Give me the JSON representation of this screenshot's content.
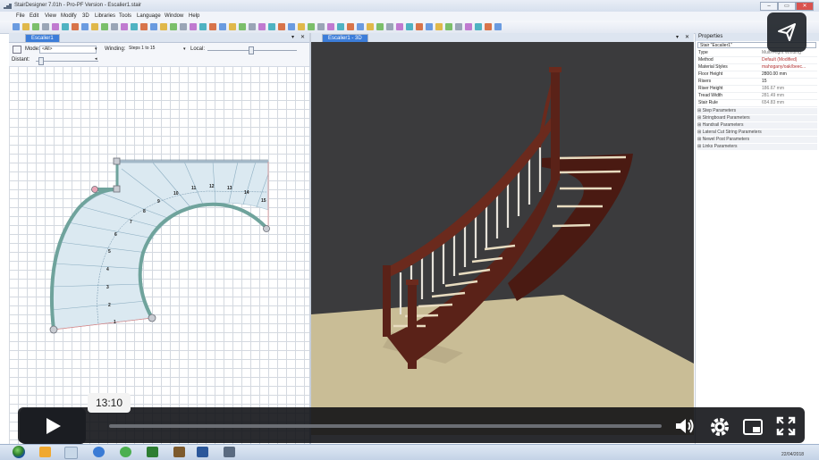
{
  "window": {
    "title": "StairDesigner 7.01h - Pro-PF Version - Escalier1.stair",
    "minimize_label": "–",
    "maximize_label": "▭",
    "close_label": "✕"
  },
  "menu": [
    "File",
    "Edit",
    "View",
    "Modify",
    "3D",
    "Libraries",
    "Tools",
    "Language",
    "Window",
    "Help"
  ],
  "left_pane": {
    "tab_label": "Escalier1",
    "mode_label": "Mode:",
    "mode_value": "<All>",
    "winding_label": "Winding:",
    "winding_value": "Steps 1 to 15",
    "local_label": "Local:",
    "distant_label": "Distant:",
    "step_numbers": [
      "1",
      "2",
      "3",
      "4",
      "5",
      "6",
      "7",
      "8",
      "9",
      "10",
      "11",
      "12",
      "13",
      "14",
      "15"
    ]
  },
  "right_pane": {
    "tab_label": "Escalier1 - 3D"
  },
  "properties": {
    "header": "Properties",
    "selected": "Stair \"Escalier1\"",
    "rows": [
      {
        "key": "Type",
        "value": "Multi-Flight Winding",
        "emph": false
      },
      {
        "key": "Method",
        "value": "Default (Modified)",
        "emph": true
      },
      {
        "key": "Material Styles",
        "value": "mahogany/oak/beec...",
        "emph": true
      },
      {
        "key": "Floor Height",
        "value": "2800.00 mm",
        "emph": false
      },
      {
        "key": "Risers",
        "value": "15",
        "emph": false
      },
      {
        "key": "Riser Height",
        "value": "186.67 mm",
        "emph": false
      },
      {
        "key": "Tread Width",
        "value": "281.49 mm",
        "emph": false
      },
      {
        "key": "Stair Rule",
        "value": "654.83 mm",
        "emph": false
      }
    ],
    "groups": [
      "Step Parameters",
      "Stringboard Parameters",
      "Handrail Parameters",
      "Lateral Cut String Parameters",
      "Newel Post Parameters",
      "Links Parameters"
    ]
  },
  "taskbar": {
    "date": "22/04/2018"
  },
  "player": {
    "time_tooltip": "13:10",
    "progress": 0.0
  },
  "colors": {
    "viewport_bg": "#3b3b3d",
    "floor": "#c9bd96",
    "wood": "#5a2218",
    "plan_fill": "#dbe9f1",
    "stringer": "#6fa39c"
  }
}
